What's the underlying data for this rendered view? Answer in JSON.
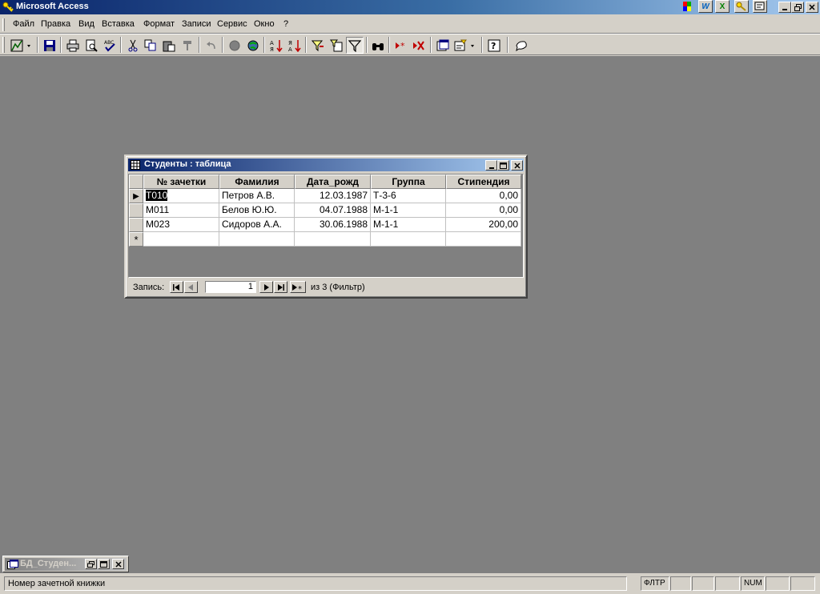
{
  "app": {
    "title": "Microsoft Access"
  },
  "menu": [
    "Файл",
    "Правка",
    "Вид",
    "Вставка",
    "Формат",
    "Записи",
    "Сервис",
    "Окно",
    "?"
  ],
  "tray": [
    "W",
    "X",
    "",
    ""
  ],
  "child": {
    "title": "Студенты : таблица",
    "columns": [
      "№ зачетки",
      "Фамилия",
      "Дата_рожд",
      "Группа",
      "Стипендия"
    ],
    "rows": [
      [
        "T010",
        "Петров А.В.",
        "12.03.1987",
        "Т-3-6",
        "0,00"
      ],
      [
        "M011",
        "Белов Ю.Ю.",
        "04.07.1988",
        "М-1-1",
        "0,00"
      ],
      [
        "M023",
        "Сидоров А.А.",
        "30.06.1988",
        "М-1-1",
        "200,00"
      ]
    ],
    "new_row_marker": "*",
    "current_row_marker": "▶"
  },
  "nav": {
    "label": "Запись:",
    "current": "1",
    "of": "из  3 (Фильтр)"
  },
  "minimized": {
    "title": "БД_Студен..."
  },
  "status": {
    "text": "Номер зачетной книжки",
    "panels": [
      "ФЛТР",
      "",
      "",
      "",
      "NUM",
      "",
      ""
    ]
  },
  "colors": {
    "titlebar_start": "#0a246a",
    "titlebar_end": "#a6caf0",
    "mdi_background": "#808080"
  }
}
